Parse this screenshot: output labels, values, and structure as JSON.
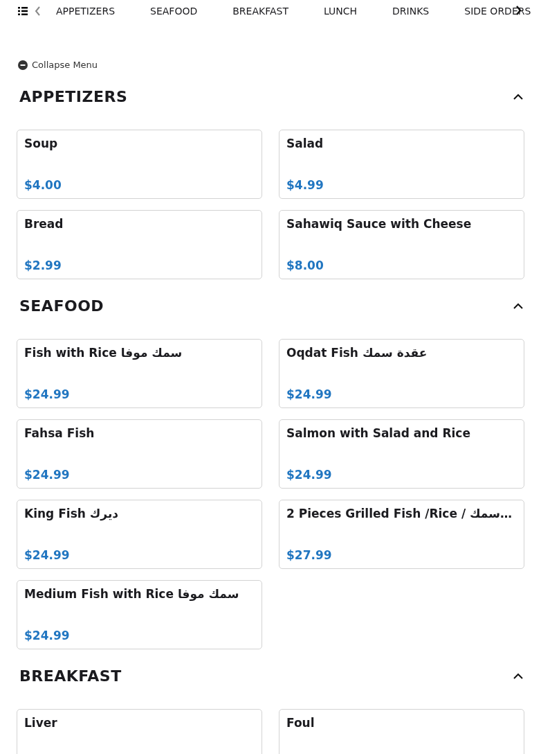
{
  "tabs": [
    {
      "label": "APPETIZERS"
    },
    {
      "label": "SEAFOOD"
    },
    {
      "label": "BREAKFAST"
    },
    {
      "label": "LUNCH"
    },
    {
      "label": "DRINKS"
    },
    {
      "label": "SIDE ORDERS"
    }
  ],
  "collapse_menu": {
    "label": "Collapse Menu"
  },
  "sections": [
    {
      "title": "APPETIZERS",
      "expanded": true,
      "items": [
        {
          "name": "Soup",
          "price": "$4.00"
        },
        {
          "name": "Salad",
          "price": "$4.99"
        },
        {
          "name": "Bread",
          "price": "$2.99"
        },
        {
          "name": "Sahawiq Sauce with Cheese",
          "price": "$8.00"
        }
      ]
    },
    {
      "title": "SEAFOOD",
      "expanded": true,
      "items": [
        {
          "name": "Fish with Rice سمك موفا",
          "price": "$24.99"
        },
        {
          "name": "Oqdat Fish عقدة سمك",
          "price": "$24.99"
        },
        {
          "name": "Fahsa Fish",
          "price": "$24.99"
        },
        {
          "name": "Salmon with Salad and Rice",
          "price": "$24.99"
        },
        {
          "name": "King Fish ديرك",
          "price": "$24.99"
        },
        {
          "name": "2 Pieces Grilled Fish /Rice / سمك…",
          "price": "$27.99"
        },
        {
          "name": "Medium Fish with Rice سمك موفا",
          "price": "$24.99"
        }
      ]
    },
    {
      "title": "BREAKFAST",
      "expanded": true,
      "items": [
        {
          "name": "Liver"
        },
        {
          "name": "Foul"
        }
      ]
    }
  ]
}
